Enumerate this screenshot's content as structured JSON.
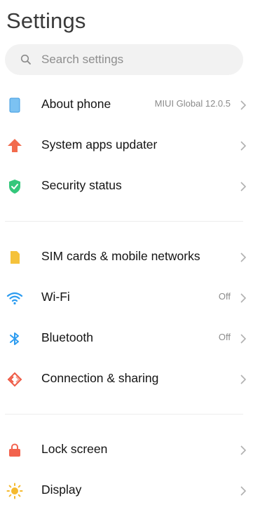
{
  "header": {
    "title": "Settings"
  },
  "search": {
    "placeholder": "Search settings"
  },
  "groups": [
    {
      "items": [
        {
          "label": "About phone",
          "value": "MIUI Global 12.0.5",
          "icon": "phone-icon",
          "color": "#5aaee8"
        },
        {
          "label": "System apps updater",
          "value": "",
          "icon": "arrow-up-icon",
          "color": "#f26b4d"
        },
        {
          "label": "Security status",
          "value": "",
          "icon": "shield-check-icon",
          "color": "#34c77b"
        }
      ]
    },
    {
      "items": [
        {
          "label": "SIM cards & mobile networks",
          "value": "",
          "icon": "sim-card-icon",
          "color": "#f5c23b"
        },
        {
          "label": "Wi-Fi",
          "value": "Off",
          "icon": "wifi-icon",
          "color": "#2d9cf0"
        },
        {
          "label": "Bluetooth",
          "value": "Off",
          "icon": "bluetooth-icon",
          "color": "#2d9cf0"
        },
        {
          "label": "Connection & sharing",
          "value": "",
          "icon": "connection-sharing-icon",
          "color": "#ee5a45"
        }
      ]
    },
    {
      "items": [
        {
          "label": "Lock screen",
          "value": "",
          "icon": "lock-icon",
          "color": "#f2624d"
        },
        {
          "label": "Display",
          "value": "",
          "icon": "sun-icon",
          "color": "#f5b92e"
        }
      ]
    }
  ]
}
